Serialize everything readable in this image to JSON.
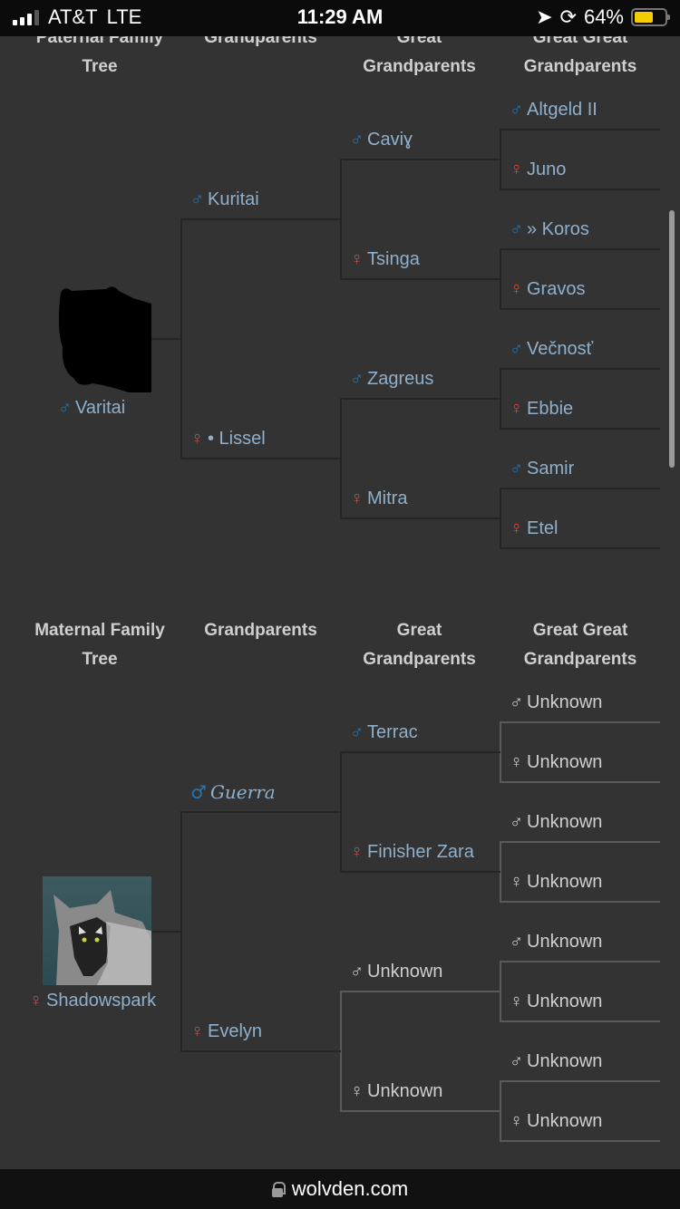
{
  "status_bar": {
    "carrier": "AT&T",
    "network": "LTE",
    "time": "11:29 AM",
    "battery_percent": "64%",
    "battery_level": 0.64
  },
  "paternal": {
    "headers": [
      "Paternal Family Tree",
      "Grandparents",
      "Great Grandparents",
      "Great Great Grandparents"
    ],
    "subject": {
      "sex": "♂",
      "name": "Varitai",
      "portrait": "black-silhouette"
    },
    "grandparents": [
      {
        "sex": "♂",
        "name": "Kuritai"
      },
      {
        "sex": "♀",
        "name": "• Lissel"
      }
    ],
    "great_grandparents": [
      {
        "sex": "♂",
        "name": "Caviɣ"
      },
      {
        "sex": "♀",
        "name": "Tsinga"
      },
      {
        "sex": "♂",
        "name": "Zagreus"
      },
      {
        "sex": "♀",
        "name": "Mitra"
      }
    ],
    "great_great_grandparents": [
      {
        "sex": "♂",
        "name": "Altgeld II"
      },
      {
        "sex": "♀",
        "name": "Juno"
      },
      {
        "sex": "♂",
        "name": "» Koros"
      },
      {
        "sex": "♀",
        "name": "Gravos"
      },
      {
        "sex": "♂",
        "name": "Večnosť"
      },
      {
        "sex": "♀",
        "name": "Ebbie"
      },
      {
        "sex": "♂",
        "name": "Samir"
      },
      {
        "sex": "♀",
        "name": "Etel"
      }
    ]
  },
  "maternal": {
    "headers": [
      "Maternal Family Tree",
      "Grandparents",
      "Great Grandparents",
      "Great Great Grandparents"
    ],
    "subject": {
      "sex": "♀",
      "name": "Shadowspark",
      "portrait": "grey-wolf"
    },
    "grandparents": [
      {
        "sex": "♂",
        "name": "Guerra"
      },
      {
        "sex": "♀",
        "name": "Evelyn"
      }
    ],
    "great_grandparents": [
      {
        "sex": "♂",
        "name": "Terrac"
      },
      {
        "sex": "♀",
        "name": "Finisher Zara"
      },
      {
        "sex": "♂",
        "name": "Unknown"
      },
      {
        "sex": "♀",
        "name": "Unknown"
      }
    ],
    "great_great_grandparents": [
      {
        "sex": "♂",
        "name": "Unknown"
      },
      {
        "sex": "♀",
        "name": "Unknown"
      },
      {
        "sex": "♂",
        "name": "Unknown"
      },
      {
        "sex": "♀",
        "name": "Unknown"
      },
      {
        "sex": "♂",
        "name": "Unknown"
      },
      {
        "sex": "♀",
        "name": "Unknown"
      },
      {
        "sex": "♂",
        "name": "Unknown"
      },
      {
        "sex": "♀",
        "name": "Unknown"
      }
    ]
  },
  "browser": {
    "url": "wolvden.com"
  },
  "colors": {
    "male": "#1f77b4",
    "female": "#e0433a",
    "name_link": "#8fb0cc",
    "unknown": "#cfcfcf",
    "background": "#333333"
  }
}
